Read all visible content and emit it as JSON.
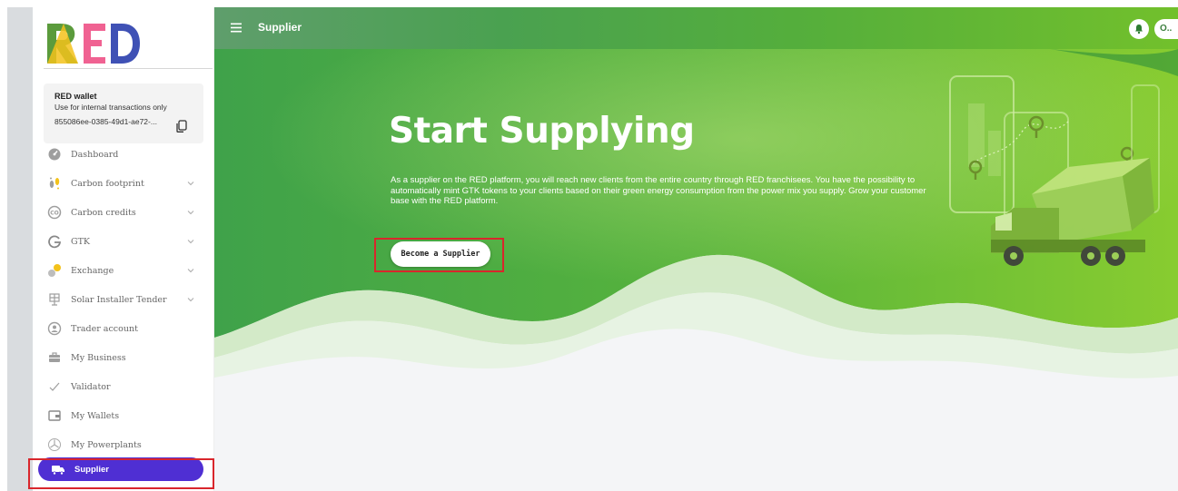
{
  "brand": {
    "logo_text": "RED",
    "active_color": "#4f2fd3",
    "hero_green": "#4caf50"
  },
  "wallet": {
    "title": "RED wallet",
    "subtitle": "Use for internal transactions only",
    "address": "855086ee-0385-49d1-ae72-..."
  },
  "nav": [
    {
      "label": "Dashboard",
      "icon": "dashboard-icon",
      "expandable": false
    },
    {
      "label": "Carbon footprint",
      "icon": "footprint-icon",
      "expandable": true
    },
    {
      "label": "Carbon credits",
      "icon": "carbon-credits-icon",
      "expandable": true
    },
    {
      "label": "GTK",
      "icon": "gtk-icon",
      "expandable": true
    },
    {
      "label": "Exchange",
      "icon": "exchange-icon",
      "expandable": true
    },
    {
      "label": "Solar Installer Tender",
      "icon": "solar-panel-icon",
      "expandable": true
    },
    {
      "label": "Trader account",
      "icon": "trader-icon",
      "expandable": false
    },
    {
      "label": "My Business",
      "icon": "briefcase-icon",
      "expandable": false
    },
    {
      "label": "Validator",
      "icon": "validator-icon",
      "expandable": false
    },
    {
      "label": "My Wallets",
      "icon": "wallet-icon",
      "expandable": false
    },
    {
      "label": "My Powerplants",
      "icon": "powerplant-icon",
      "expandable": false
    }
  ],
  "nav_active": {
    "label": "Supplier",
    "icon": "truck-icon"
  },
  "topbar": {
    "title": "Supplier",
    "avatar_text": "O..",
    "bell_icon": "bell-icon"
  },
  "hero": {
    "title": "Start Supplying",
    "text": "As a supplier on the RED platform, you will reach new clients from the entire country through RED franchisees. You have the possibility to automatically mint GTK tokens to your clients based on their green energy consumption from the power mix you supply. Grow your customer base with the RED platform.",
    "cta_label": "Become a Supplier"
  }
}
